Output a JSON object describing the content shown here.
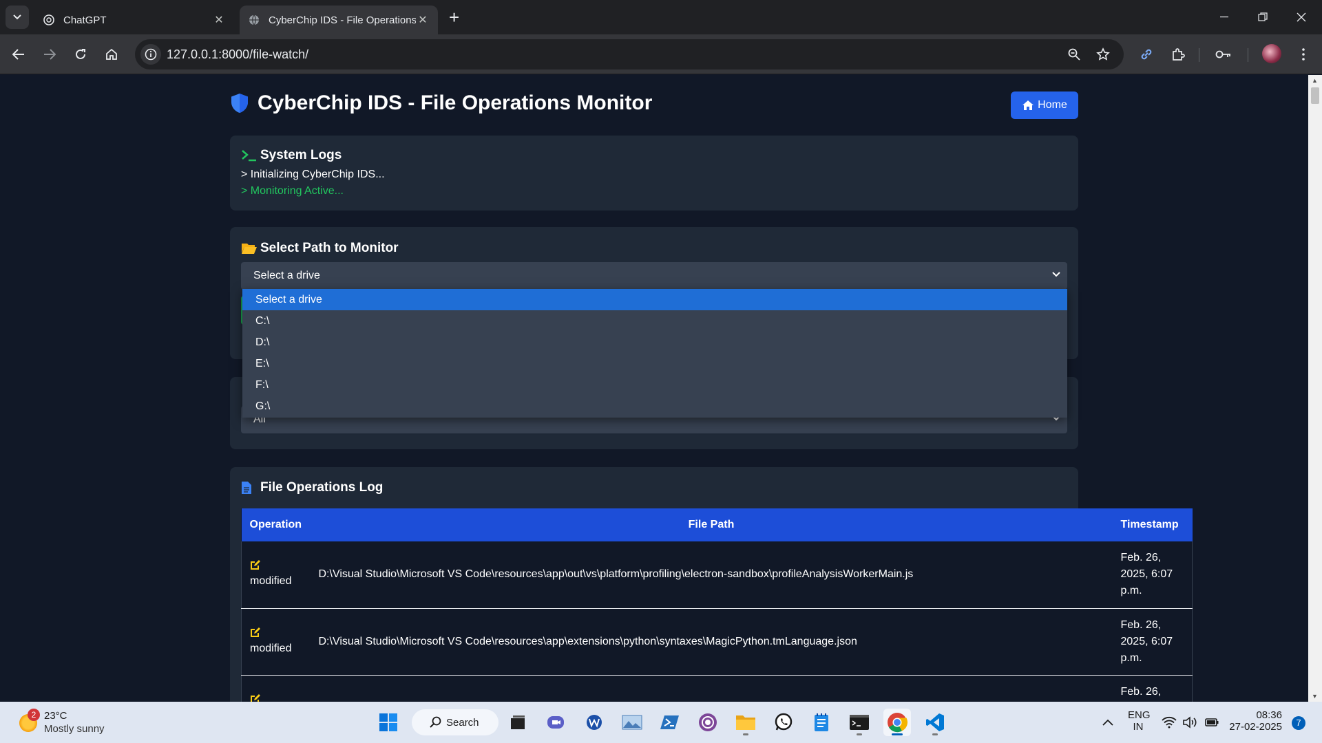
{
  "browser": {
    "tabs": [
      {
        "title": "ChatGPT",
        "active": false
      },
      {
        "title": "CyberChip IDS - File Operations",
        "active": true
      }
    ],
    "url": "127.0.0.1:8000/file-watch/"
  },
  "page": {
    "title": "CyberChip IDS - File Operations Monitor",
    "home_label": "Home",
    "system_logs": {
      "title": "System Logs",
      "lines": [
        "> Initializing CyberChip IDS...",
        "> Monitoring Active..."
      ]
    },
    "path_select": {
      "title": "Select Path to Monitor",
      "selected": "Select a drive",
      "options": [
        "Select a drive",
        "C:\\",
        "D:\\",
        "E:\\",
        "F:\\",
        "G:\\"
      ]
    },
    "operation_filter": {
      "selected": "All"
    },
    "file_ops": {
      "title": "File Operations Log",
      "columns": [
        "Operation",
        "File Path",
        "Timestamp"
      ],
      "rows": [
        {
          "operation": "modified",
          "path": "D:\\Visual Studio\\Microsoft VS Code\\resources\\app\\out\\vs\\platform\\profiling\\electron-sandbox\\profileAnalysisWorkerMain.js",
          "timestamp": "Feb. 26, 2025, 6:07 p.m."
        },
        {
          "operation": "modified",
          "path": "D:\\Visual Studio\\Microsoft VS Code\\resources\\app\\extensions\\python\\syntaxes\\MagicPython.tmLanguage.json",
          "timestamp": "Feb. 26, 2025, 6:07 p.m."
        },
        {
          "operation": "",
          "path": "",
          "timestamp": "Feb. 26,"
        }
      ]
    },
    "colors": {
      "background": "#111827",
      "card": "#1f2937",
      "accent": "#2563eb",
      "table_header": "#1d4ed8",
      "success": "#22c55e",
      "warning_icon": "#facc15"
    }
  },
  "taskbar": {
    "weather": {
      "temp": "23°C",
      "desc": "Mostly sunny",
      "badge": "2"
    },
    "search_label": "Search",
    "lang": [
      "ENG",
      "IN"
    ],
    "time": "08:36",
    "date": "27-02-2025",
    "notifications": "7"
  }
}
